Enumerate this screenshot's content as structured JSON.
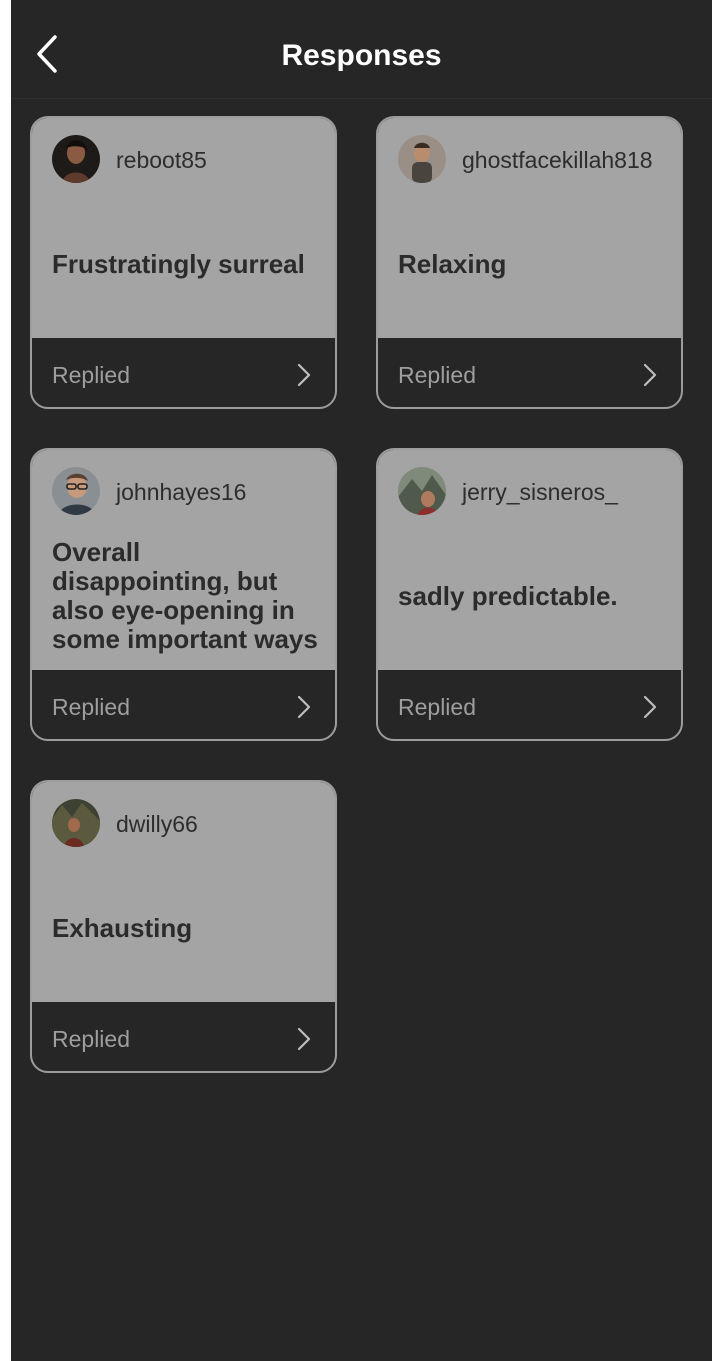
{
  "header": {
    "title": "Responses",
    "back_icon": "chevron-left-icon"
  },
  "colors": {
    "background": "#262626",
    "card_top": "#a4a4a4",
    "card_border": "#9c9c9c",
    "title_text": "#ffffff",
    "status_text": "#9e9e9e"
  },
  "responses": [
    {
      "username": "reboot85",
      "response": "Frustratingly surreal",
      "status": "Replied",
      "chevron_icon": "chevron-right-icon"
    },
    {
      "username": "ghostfacekillah818",
      "response": "Relaxing",
      "status": "Replied",
      "chevron_icon": "chevron-right-icon"
    },
    {
      "username": "johnhayes16",
      "response": "Overall disappointing, but also eye-opening in some important ways",
      "status": "Replied",
      "chevron_icon": "chevron-right-icon"
    },
    {
      "username": "jerry_sisneros_",
      "response": "sadly predictable.",
      "status": "Replied",
      "chevron_icon": "chevron-right-icon"
    },
    {
      "username": "dwilly66",
      "response": "Exhausting",
      "status": "Replied",
      "chevron_icon": "chevron-right-icon"
    }
  ]
}
